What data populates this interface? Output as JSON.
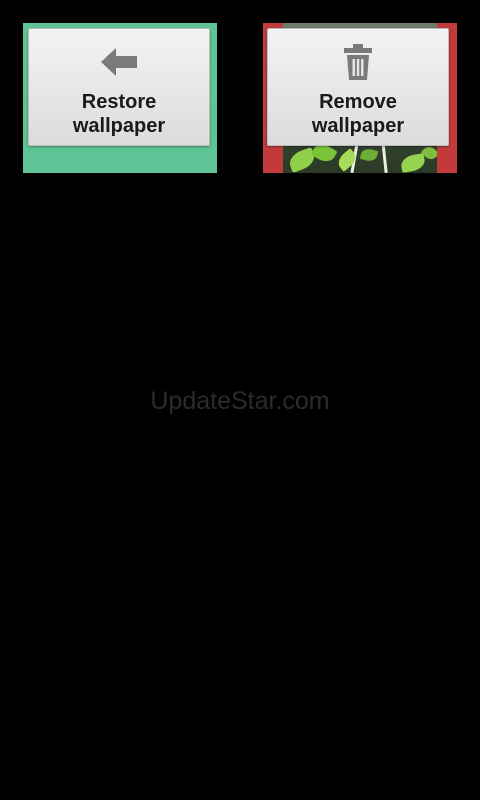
{
  "tiles": {
    "restore": {
      "label": "Restore\nwallpaper",
      "icon": "arrow-left-icon",
      "color": "#5fc495"
    },
    "remove": {
      "label": "Remove\nwallpaper",
      "icon": "trash-icon",
      "color": "#c23a3a"
    }
  },
  "watermark": "UpdateStar.com",
  "colors": {
    "background": "#000000",
    "icon": "#7a7a7a",
    "card": "#e6e6e6"
  }
}
